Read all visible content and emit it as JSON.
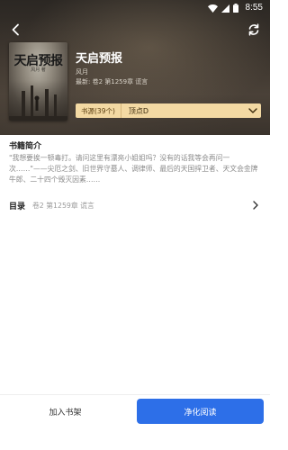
{
  "status_bar": {
    "time": "8:55"
  },
  "book": {
    "cover_title": "天启预报",
    "cover_subtitle": "风月 著",
    "title": "天启预报",
    "author": "风月",
    "latest_label": "最新: 卷2 第1259章 谎言"
  },
  "source": {
    "count_label": "书源(39个)",
    "name": "顶点D"
  },
  "intro": {
    "heading": "书籍简介",
    "text": "\"我想要挨一顿毒打。请问这里有漂亮小姐姐吗？没有的话我等会再问一次……\"——尖厄之剑、旧世界守墓人、调律师、最后的天国捍卫者、天文会金牌牛郎、二十四个毁灭因素……"
  },
  "toc": {
    "label": "目录",
    "latest": "卷2 第1259章 谎言"
  },
  "actions": {
    "add_shelf": "加入书架",
    "read": "净化阅读"
  },
  "colors": {
    "accent": "#2d6fe8",
    "source_bar": "#f3d9a3"
  }
}
